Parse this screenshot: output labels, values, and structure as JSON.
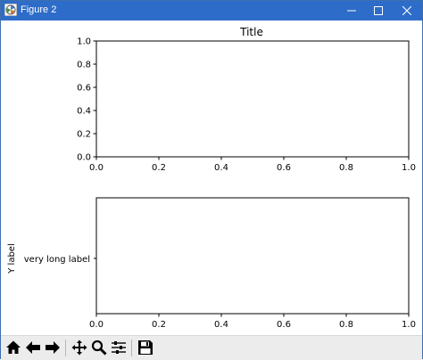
{
  "window": {
    "title": "Figure 2",
    "titlebar_color": "#2e6cc9"
  },
  "figure": {
    "top_axes": {
      "title": "Title",
      "xticks": [
        "0.0",
        "0.2",
        "0.4",
        "0.6",
        "0.8",
        "1.0"
      ],
      "yticks": [
        "0.0",
        "0.2",
        "0.4",
        "0.6",
        "0.8",
        "1.0"
      ],
      "xlim": [
        0,
        1
      ],
      "ylim": [
        0,
        1
      ]
    },
    "bottom_axes": {
      "ylabel": "Y label",
      "ytick_label": "very long label",
      "xticks": [
        "0.0",
        "0.2",
        "0.4",
        "0.6",
        "0.8",
        "1.0"
      ],
      "xlim": [
        0,
        1
      ]
    }
  },
  "toolbar": {
    "buttons": [
      {
        "name": "home",
        "icon": "home-icon"
      },
      {
        "name": "back",
        "icon": "arrow-left-icon"
      },
      {
        "name": "forward",
        "icon": "arrow-right-icon"
      },
      {
        "name": "pan",
        "icon": "move-icon"
      },
      {
        "name": "zoom",
        "icon": "magnifier-icon"
      },
      {
        "name": "configure-subplots",
        "icon": "sliders-icon"
      },
      {
        "name": "save",
        "icon": "floppy-icon"
      }
    ]
  }
}
